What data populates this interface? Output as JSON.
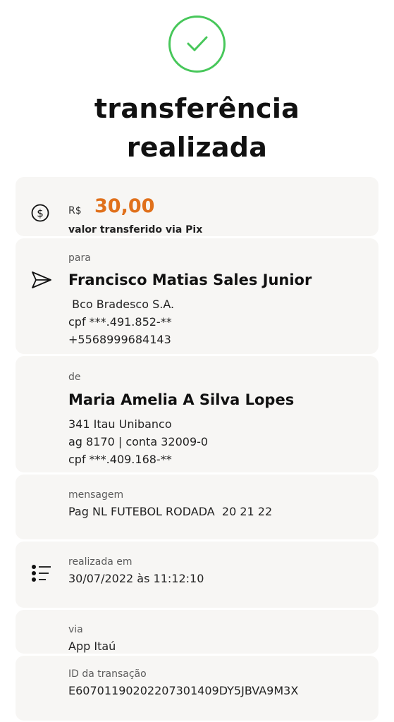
{
  "header": {
    "title_line1": "transferência",
    "title_line2": "realizada",
    "check_color": "#47c75a"
  },
  "amount": {
    "currency": "R$",
    "value": "30,00",
    "subtitle": "valor transferido via Pix",
    "accent_color": "#e0701b"
  },
  "recipient": {
    "label": "para",
    "name": "Francisco Matias Sales Junior",
    "bank": " Bco Bradesco S.A.",
    "cpf": "cpf ***.491.852-**",
    "phone": "+5568999684143"
  },
  "sender": {
    "label": "de",
    "name": "Maria Amelia A Silva Lopes",
    "bank": "341 Itau Unibanco",
    "account": "ag 8170 | conta 32009-0",
    "cpf": "cpf ***.409.168-**"
  },
  "message": {
    "label": "mensagem",
    "value": "Pag NL FUTEBOL RODADA  20 21 22"
  },
  "date": {
    "label": "realizada em",
    "value": "30/07/2022 às 11:12:10"
  },
  "via": {
    "label": "via",
    "value": "App Itaú"
  },
  "transaction": {
    "label": "ID da transação",
    "value": "E60701190202207301409DY5JBVA9M3X"
  },
  "icons": [
    "check-icon",
    "dollar-circle-icon",
    "send-icon",
    "list-icon"
  ]
}
